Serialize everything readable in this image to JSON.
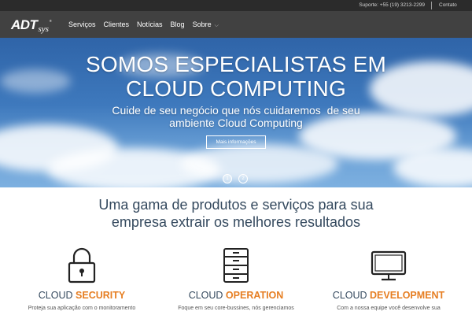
{
  "topbar": {
    "support": "Suporte: +55 (19) 3213-2299",
    "contact": "Contato"
  },
  "logo": {
    "main": "ADT",
    "suffix": "sys",
    "reg": "®"
  },
  "nav": {
    "items": [
      "Serviços",
      "Clientes",
      "Notícias",
      "Blog",
      "Sobre"
    ],
    "chevron": "⌵"
  },
  "hero": {
    "title_line1": "SOMOS ESPECIALISTAS EM",
    "title_line2": "CLOUD COMPUTING",
    "subtitle_line1": "Cuide de seu negócio que nós cuidaremos  de seu",
    "subtitle_line2": "ambiente Cloud Computing",
    "button": "Mais informações",
    "slides": [
      "1",
      "2"
    ]
  },
  "section": {
    "title_line1": "Uma gama de produtos e serviços para sua",
    "title_line2": "empresa extrair os melhores resultados"
  },
  "features": [
    {
      "prefix": "CLOUD ",
      "highlight": "SECURITY",
      "icon": "padlock-icon",
      "desc": "Proteja sua aplicação com o monitoramento"
    },
    {
      "prefix": "CLOUD ",
      "highlight": "OPERATION",
      "icon": "file-cabinet-icon",
      "desc": "Foque em seu core-bussines, nós gerenciamos"
    },
    {
      "prefix": "CLOUD ",
      "highlight": "DEVELOPMENT",
      "icon": "monitor-icon",
      "desc": "Com a nossa equipe você desenvolve sua"
    }
  ],
  "colors": {
    "accent": "#e67e22",
    "heading": "#34495e",
    "navbar": "#414141",
    "topbar": "#2b2b2b"
  }
}
